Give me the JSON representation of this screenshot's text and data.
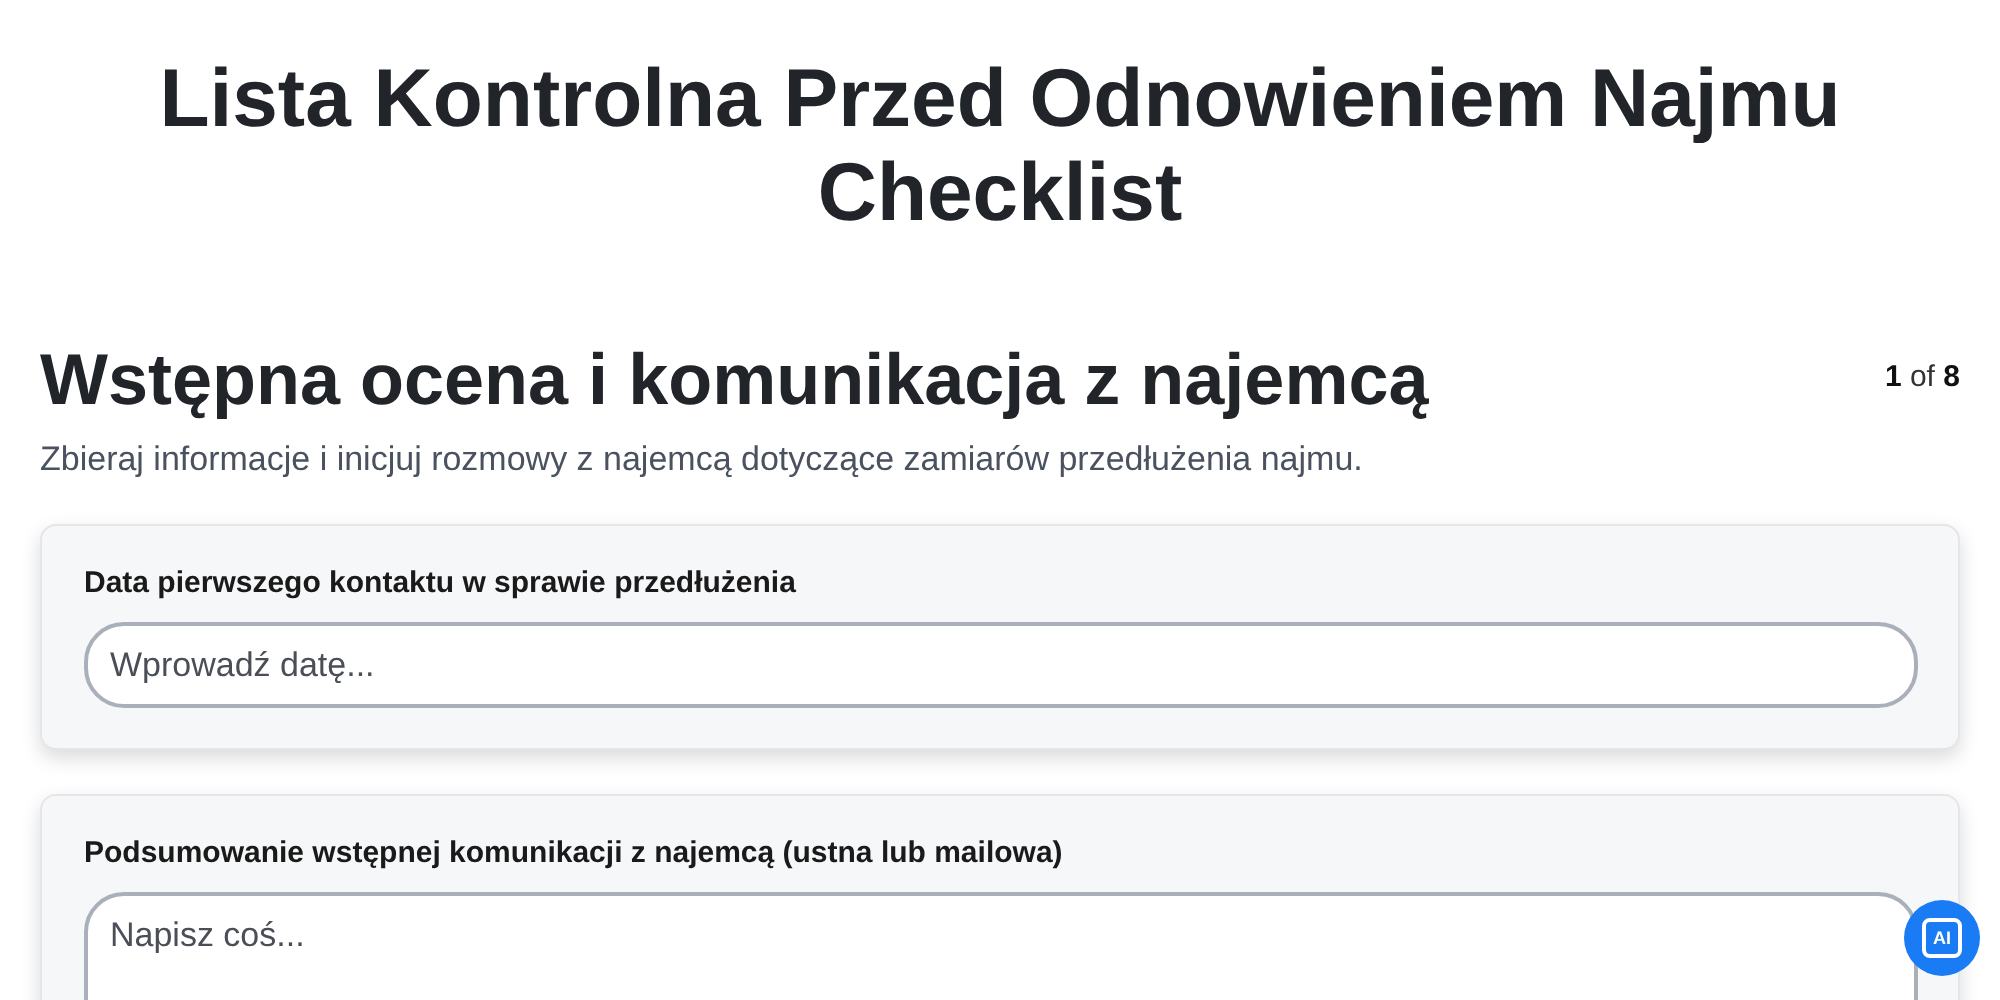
{
  "title": "Lista Kontrolna Przed Odnowieniem Najmu Checklist",
  "section": {
    "heading": "Wstępna ocena i komunikacja z najemcą",
    "counter": "**1** of **8**",
    "description": "Zbieraj informacje i inicjuj rozmowy z najemcą dotyczące zamiarów przedłużenia najmu."
  },
  "fields": [
    {
      "kind": "input",
      "label": "Data pierwszego kontaktu w sprawie przedłużenia",
      "placeholder": "Wprowadź datę..."
    },
    {
      "kind": "textarea",
      "label": "Podsumowanie wstępnej komunikacji z najemcą (ustna lub mailowa)",
      "placeholder": "Napisz coś..."
    }
  ],
  "assistant_button": {
    "label": "AI"
  }
}
